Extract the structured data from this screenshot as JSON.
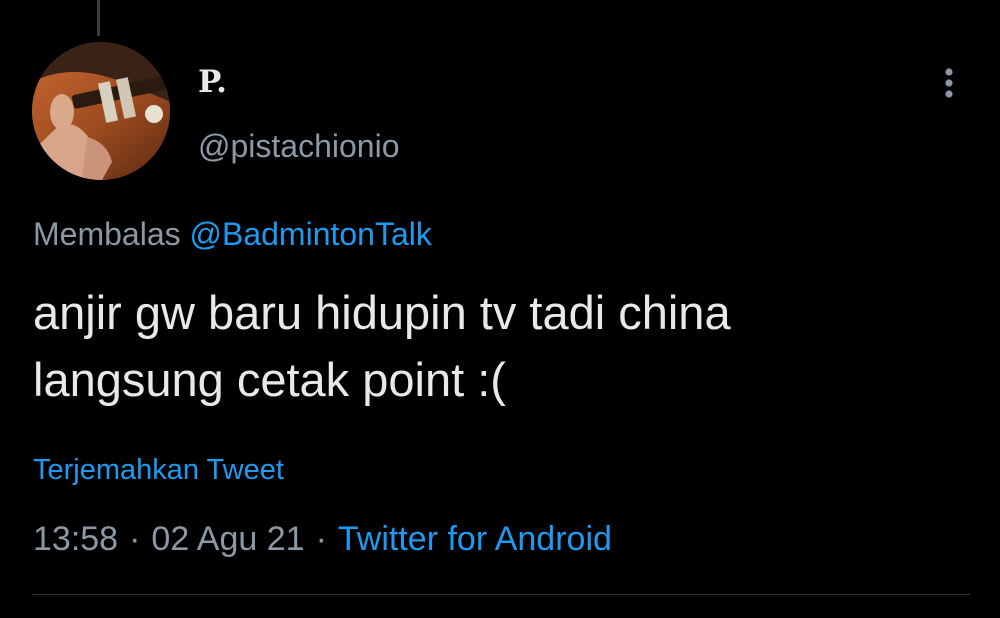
{
  "tweet": {
    "author": {
      "display_name": "P.",
      "handle": "@pistachionio",
      "avatar_description": "avatar-guitar-photo"
    },
    "reply": {
      "prefix": "Membalas ",
      "mention": "@BadmintonTalk"
    },
    "text_line_1": "anjir gw baru hidupin tv tadi china",
    "text_line_2": "langsung cetak point :(",
    "translate_label": "Terjemahkan Tweet",
    "time": "13:58",
    "date": "02 Agu 21",
    "separator": "·",
    "source": "Twitter for Android"
  },
  "icons": {
    "more": "more-vertical-icon"
  },
  "colors": {
    "background": "#000000",
    "primary_text": "#e7e9ea",
    "secondary_text": "#8b98a5",
    "link": "#1d9bf0",
    "divider": "#2f3336"
  }
}
